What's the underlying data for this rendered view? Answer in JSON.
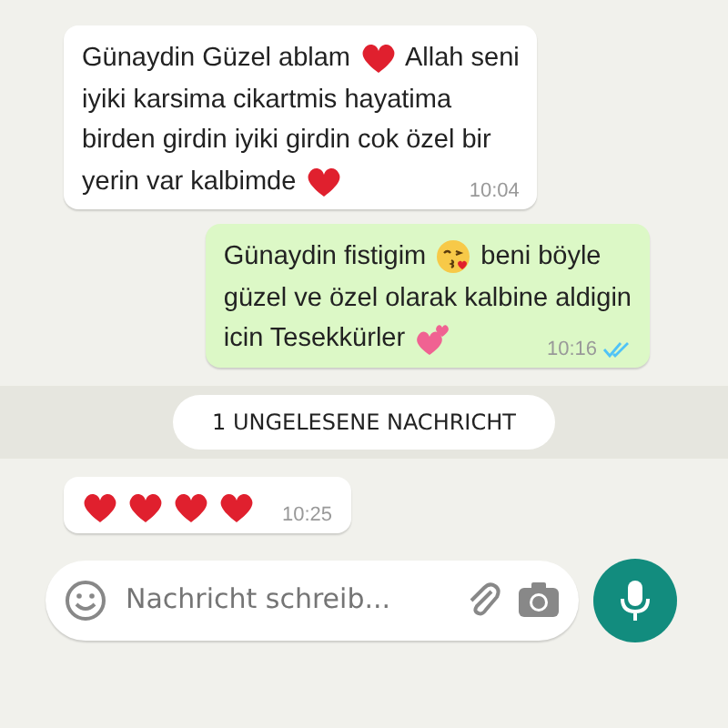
{
  "messages": [
    {
      "kind": "incoming",
      "lines": [
        [
          {
            "kind": "text",
            "text": "Günaydin Güzel ablam"
          },
          {
            "kind": "heart"
          },
          {
            "kind": "text",
            "text": "Allah seni"
          }
        ],
        [
          {
            "kind": "text",
            "text": "iyiki karsima cikartmis hayatima"
          }
        ],
        [
          {
            "kind": "text",
            "text": "birden girdin iyiki girdin cok özel bir"
          }
        ],
        [
          {
            "kind": "text",
            "text": "yerin var kalbimde"
          },
          {
            "kind": "heart"
          }
        ]
      ],
      "time": "10:04"
    },
    {
      "kind": "outgoing",
      "lines": [
        [
          {
            "kind": "text",
            "text": "Günaydin fistigim"
          },
          {
            "kind": "kiss"
          },
          {
            "kind": "text",
            "text": "beni böyle"
          }
        ],
        [
          {
            "kind": "text",
            "text": "güzel ve özel olarak kalbine aldigin"
          }
        ],
        [
          {
            "kind": "text",
            "text": "icin Tesekkürler"
          },
          {
            "kind": "hearts"
          }
        ]
      ],
      "time": "10:16",
      "read": true
    },
    {
      "kind": "divider",
      "text": "1 UNGELESENE NACHRICHT"
    },
    {
      "kind": "incoming",
      "lines": [
        [
          {
            "kind": "heart"
          },
          {
            "kind": "heart"
          },
          {
            "kind": "heart"
          },
          {
            "kind": "heart"
          }
        ]
      ],
      "time": "10:25"
    }
  ],
  "composer": {
    "placeholder": "Nachricht schreib..."
  }
}
